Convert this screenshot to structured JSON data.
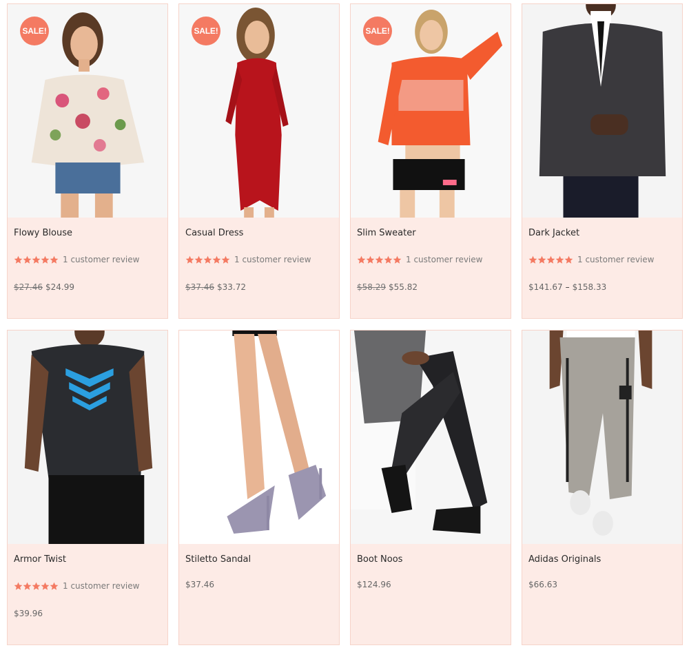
{
  "colors": {
    "accent": "#f47a62",
    "card_bg": "#fdebe6"
  },
  "products": [
    {
      "name": "Flowy Blouse",
      "sale_label": "SALE!",
      "stars": 5,
      "review": "1 customer review",
      "old_price": "$27.46",
      "price": "$24.99"
    },
    {
      "name": "Casual Dress",
      "sale_label": "SALE!",
      "stars": 5,
      "review": "1 customer review",
      "old_price": "$37.46",
      "price": "$33.72"
    },
    {
      "name": "Slim Sweater",
      "sale_label": "SALE!",
      "stars": 5,
      "review": "1 customer review",
      "old_price": "$58.29",
      "price": "$55.82"
    },
    {
      "name": "Dark Jacket",
      "stars": 5,
      "review": "1 customer review",
      "price_min": "$141.67",
      "price_sep": "–",
      "price_max": "$158.33"
    },
    {
      "name": "Armor Twist",
      "stars": 5,
      "review": "1 customer review",
      "price": "$39.96"
    },
    {
      "name": "Stiletto Sandal",
      "price": "$37.46"
    },
    {
      "name": "Boot Noos",
      "price": "$124.96"
    },
    {
      "name": "Adidas Originals",
      "price": "$66.63"
    }
  ]
}
